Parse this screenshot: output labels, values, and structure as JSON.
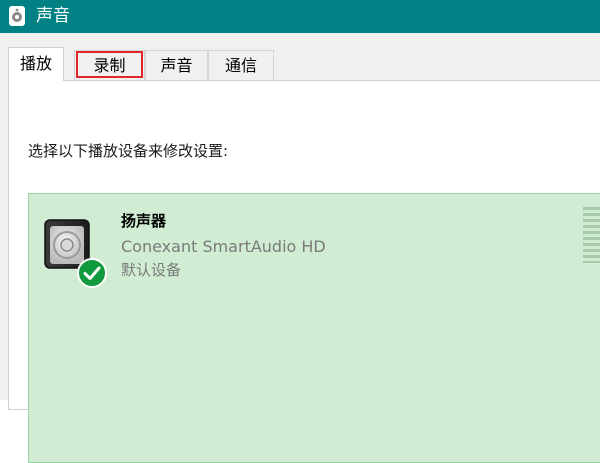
{
  "window": {
    "title": "声音",
    "icon": "speaker-icon"
  },
  "tabs": [
    {
      "label": "播放",
      "active": true
    },
    {
      "label": "录制",
      "highlighted": true,
      "highlight_color": "#e0262a"
    },
    {
      "label": "声音"
    },
    {
      "label": "通信"
    }
  ],
  "playback": {
    "instruction": "选择以下播放设备来修改设置:",
    "devices": [
      {
        "name": "扬声器",
        "description": "Conexant SmartAudio HD",
        "status": "默认设备",
        "icon": "speaker-device-icon",
        "badge": "default-check-icon"
      }
    ]
  },
  "colors": {
    "titlebar": "#008284",
    "selected_row": "#d0edd3",
    "default_badge": "#109a3e"
  }
}
